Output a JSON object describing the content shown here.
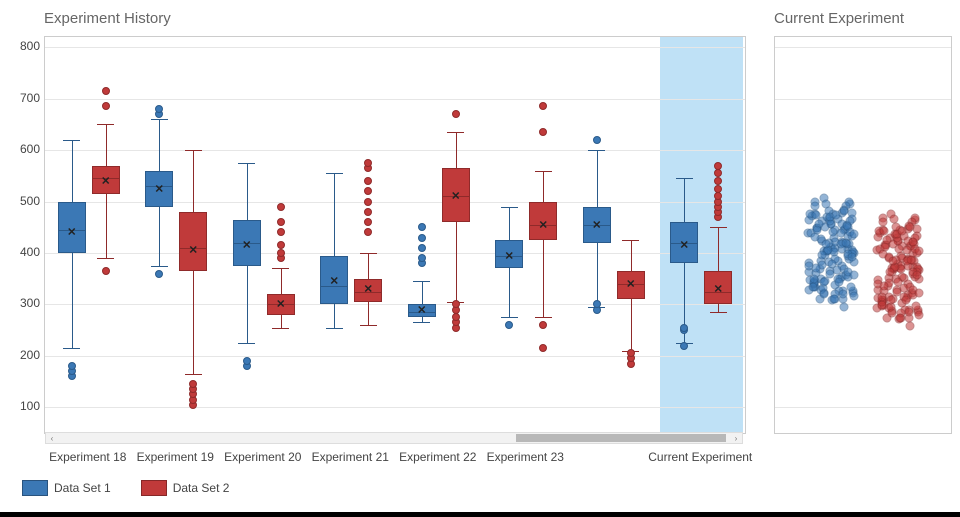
{
  "titles": {
    "history": "Experiment History",
    "current": "Current Experiment"
  },
  "legend": {
    "set1": "Data Set 1",
    "set2": "Data Set 2"
  },
  "colors": {
    "set1_fill": "#3b78b5",
    "set1_stroke": "#2a5a8a",
    "set2_fill": "#c03a3a",
    "set2_stroke": "#8f2a2a",
    "highlight": "#bfe1f6"
  },
  "yaxis": {
    "min": 50,
    "max": 820,
    "ticks": [
      100,
      200,
      300,
      400,
      500,
      600,
      700,
      800
    ]
  },
  "categories": [
    "Experiment 18",
    "Experiment 19",
    "Experiment 20",
    "Experiment 21",
    "Experiment 22",
    "Experiment 23",
    "",
    "Current Experiment"
  ],
  "chart_data": {
    "history": {
      "type": "box",
      "ylim": [
        50,
        820
      ],
      "categories": [
        "Experiment 18",
        "Experiment 19",
        "Experiment 20",
        "Experiment 21",
        "Experiment 22",
        "Experiment 23",
        "Current Experiment"
      ],
      "series": [
        {
          "name": "Data Set 1",
          "boxes": [
            {
              "category": "Experiment 18",
              "whisker_low": 215,
              "q1": 400,
              "median": 445,
              "mean": 440,
              "q3": 500,
              "whisker_high": 620,
              "outliers": [
                160,
                170,
                180
              ]
            },
            {
              "category": "Experiment 19",
              "whisker_low": 375,
              "q1": 490,
              "median": 530,
              "mean": 525,
              "q3": 560,
              "whisker_high": 660,
              "outliers": [
                360,
                670,
                680
              ]
            },
            {
              "category": "Experiment 20",
              "whisker_low": 225,
              "q1": 375,
              "median": 420,
              "mean": 415,
              "q3": 465,
              "whisker_high": 575,
              "outliers": [
                180,
                190
              ]
            },
            {
              "category": "Experiment 21",
              "whisker_low": 255,
              "q1": 300,
              "median": 335,
              "mean": 345,
              "q3": 395,
              "whisker_high": 555,
              "outliers": []
            },
            {
              "category": "Experiment 22",
              "whisker_low": 265,
              "q1": 275,
              "median": 285,
              "mean": 290,
              "q3": 300,
              "whisker_high": 345,
              "outliers": [
                380,
                390,
                410,
                430,
                450
              ]
            },
            {
              "category": "Experiment 23",
              "whisker_low": 275,
              "q1": 370,
              "median": 395,
              "mean": 395,
              "q3": 425,
              "whisker_high": 490,
              "outliers": [
                260
              ]
            },
            {
              "category": "Current Experiment",
              "whisker_low": 225,
              "q1": 380,
              "median": 420,
              "mean": 415,
              "q3": 460,
              "whisker_high": 545,
              "outliers": [
                220,
                250,
                255
              ]
            }
          ]
        },
        {
          "name": "Data Set 2",
          "boxes": [
            {
              "category": "Experiment 18",
              "whisker_low": 390,
              "q1": 515,
              "median": 545,
              "mean": 540,
              "q3": 570,
              "whisker_high": 650,
              "outliers": [
                365,
                685,
                715
              ]
            },
            {
              "category": "Experiment 19",
              "whisker_low": 165,
              "q1": 365,
              "median": 410,
              "mean": 405,
              "q3": 480,
              "whisker_high": 600,
              "outliers": [
                105,
                115,
                125,
                135,
                145
              ]
            },
            {
              "category": "Experiment 20",
              "whisker_low": 255,
              "q1": 280,
              "median": 300,
              "mean": 300,
              "q3": 320,
              "whisker_high": 370,
              "outliers": [
                390,
                400,
                415,
                440,
                460,
                490
              ]
            },
            {
              "category": "Experiment 21",
              "whisker_low": 260,
              "q1": 305,
              "median": 325,
              "mean": 330,
              "q3": 350,
              "whisker_high": 400,
              "outliers": [
                440,
                460,
                480,
                500,
                520,
                540,
                565,
                575
              ]
            },
            {
              "category": "Experiment 22",
              "whisker_low": 305,
              "q1": 460,
              "median": 510,
              "mean": 510,
              "q3": 565,
              "whisker_high": 635,
              "outliers": [
                255,
                265,
                275,
                290,
                300,
                670
              ]
            },
            {
              "category": "Experiment 23",
              "whisker_low": 275,
              "q1": 425,
              "median": 455,
              "mean": 455,
              "q3": 500,
              "whisker_high": 560,
              "outliers": [
                215,
                260,
                635,
                685
              ]
            },
            {
              "category": "Current Experiment",
              "whisker_low": 285,
              "q1": 300,
              "median": 325,
              "mean": 330,
              "q3": 365,
              "whisker_high": 450,
              "outliers": [
                470,
                480,
                490,
                500,
                510,
                525,
                540,
                555,
                570
              ]
            }
          ]
        }
      ],
      "secondary_small": {
        "category_index": 6,
        "series": [
          {
            "name": "Data Set 1",
            "boxes": [
              {
                "whisker_low": 295,
                "q1": 420,
                "median": 455,
                "mean": 455,
                "q3": 490,
                "whisker_high": 600,
                "outliers": [
                  290,
                  300,
                  620
                ]
              }
            ]
          },
          {
            "name": "Data Set 2",
            "boxes": [
              {
                "whisker_low": 210,
                "q1": 310,
                "median": 340,
                "mean": 340,
                "q3": 365,
                "whisker_high": 425,
                "outliers": [
                  185,
                  195,
                  205
                ]
              }
            ]
          }
        ]
      }
    },
    "current_scatter": {
      "type": "scatter",
      "note": "jittered strip plot representing raw points for Current Experiment, Data Set 1 left (blue) and Data Set 2 right (red)",
      "set1_y_range": [
        230,
        530
      ],
      "set1_density_peak": 420,
      "set2_y_range": [
        255,
        570
      ],
      "set2_density_peak": 320
    }
  }
}
